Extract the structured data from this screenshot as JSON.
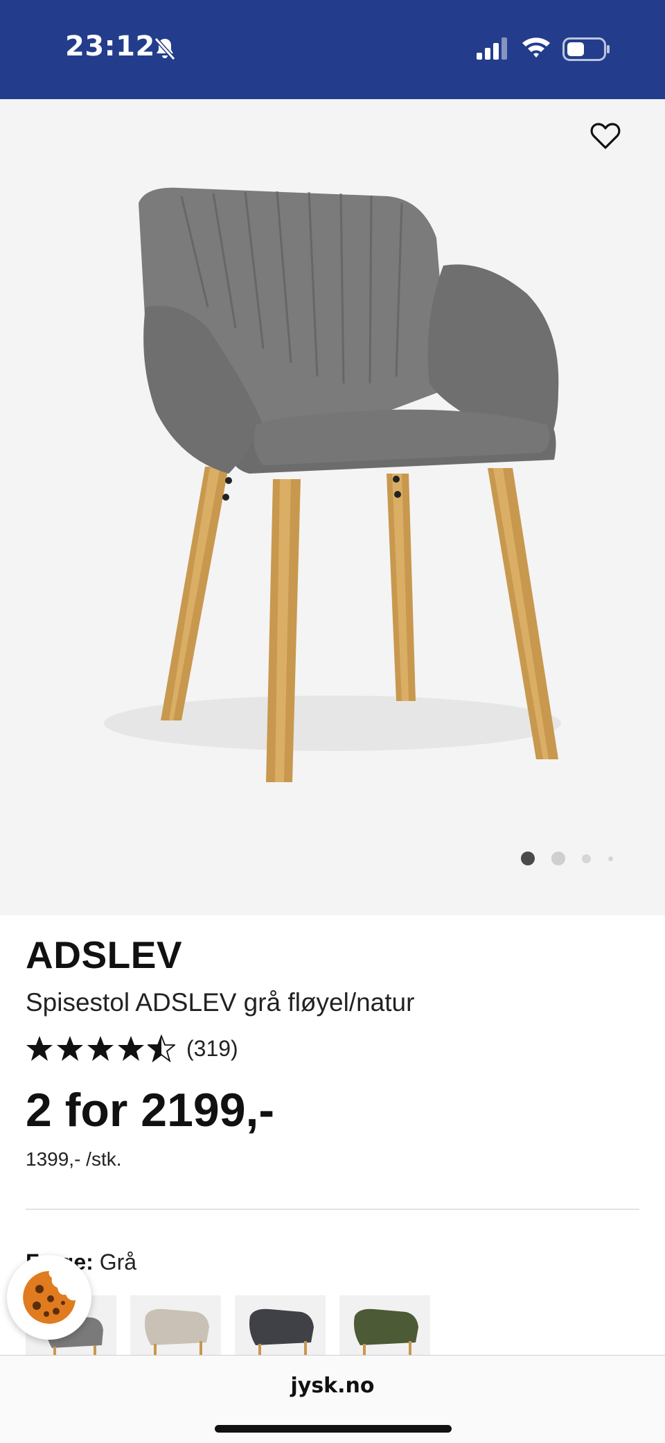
{
  "status_bar": {
    "time": "23:12",
    "icons": [
      "bell-muted-icon",
      "signal-icon",
      "wifi-icon",
      "battery-icon"
    ],
    "background": "#233d8c"
  },
  "product": {
    "image_alt_icon": "chair-product-image",
    "favorite_icon": "heart-outline-icon",
    "carousel": {
      "count": 4,
      "active": 1
    },
    "name": "ADSLEV",
    "description": "Spisestol ADSLEV grå fløyel/natur",
    "rating": {
      "value": 4.5,
      "max": 5,
      "review_count": "(319)"
    },
    "price": "2 for 2199,-",
    "unit_price": "1399,- /stk."
  },
  "color_selector": {
    "label": "Farge:",
    "value": "Grå",
    "swatches": [
      {
        "name": "Grå",
        "color": "#7a7a7a"
      },
      {
        "name": "Beige",
        "color": "#c9c1b5"
      },
      {
        "name": "Mørk grå",
        "color": "#3f4147"
      },
      {
        "name": "Grønn",
        "color": "#4c5a35"
      }
    ]
  },
  "cookie_button": {
    "icon": "cookie-icon"
  },
  "browser": {
    "url": "jysk.no"
  }
}
